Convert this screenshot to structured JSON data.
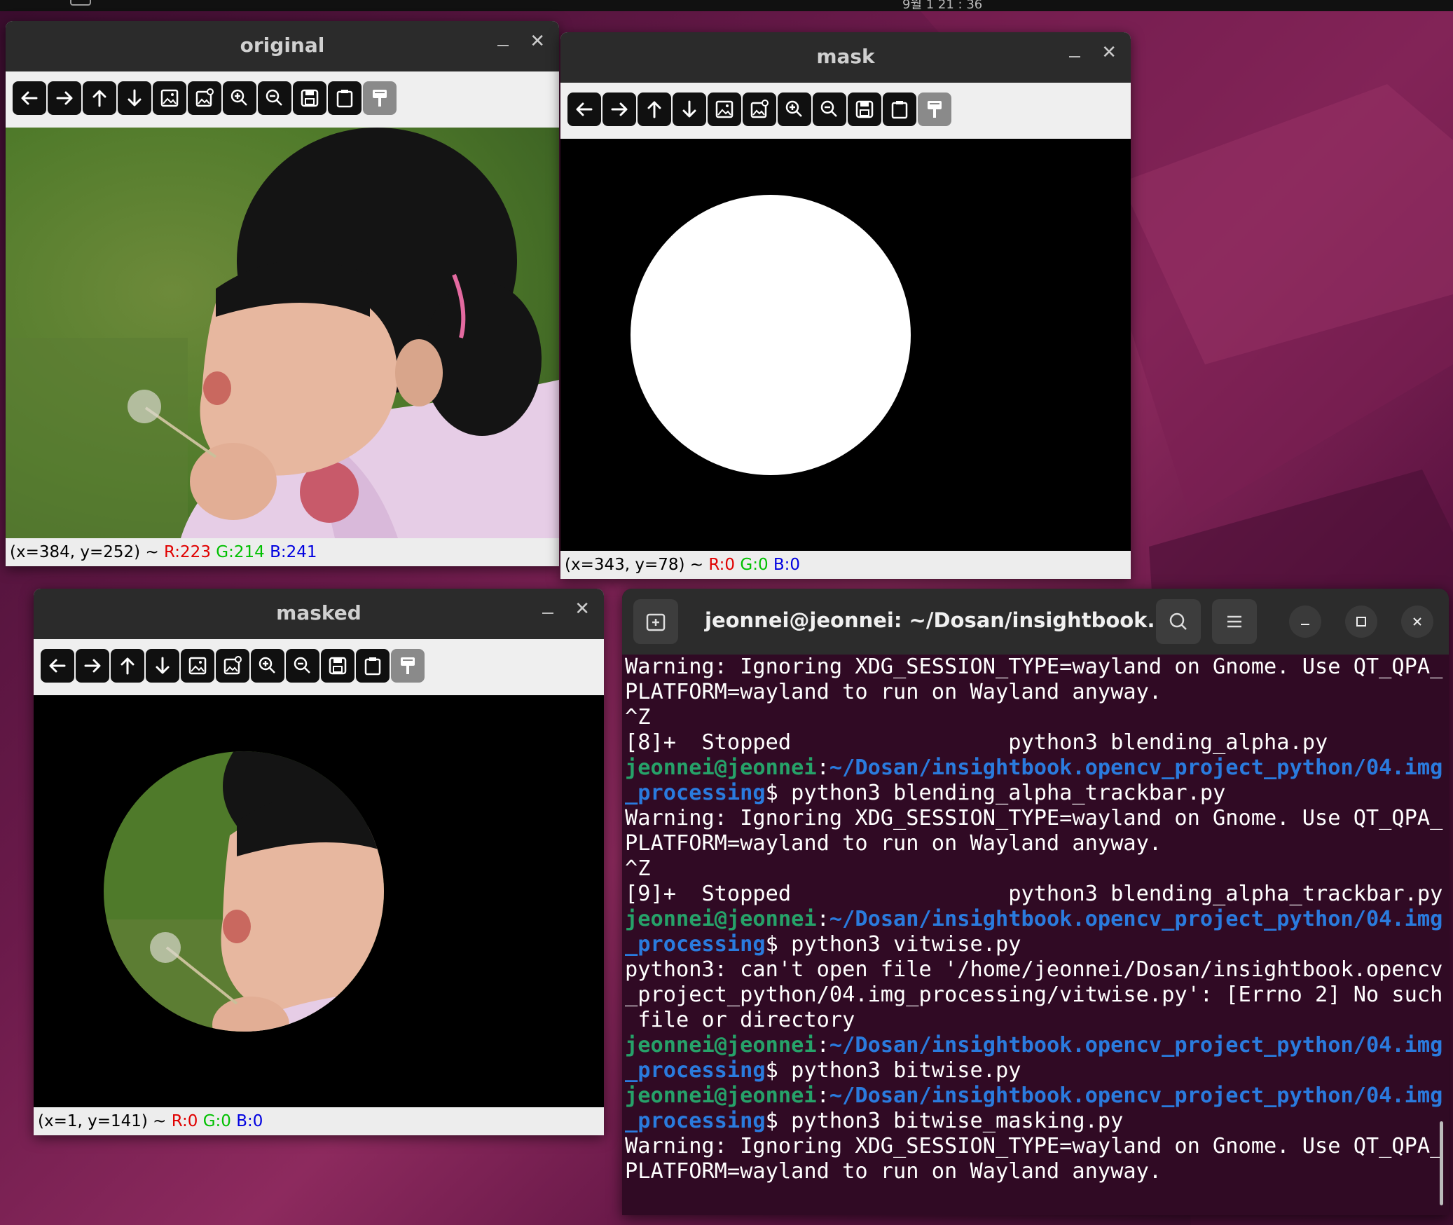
{
  "topbar": {
    "clock": "9월 1 21 : 36"
  },
  "windows": {
    "original": {
      "title": "original",
      "close_glyph": "✕",
      "status": {
        "coords": "(x=384, y=252) ~ ",
        "r": "R:223",
        "g": "G:214",
        "b": "B:241"
      }
    },
    "mask": {
      "title": "mask",
      "close_glyph": "✕",
      "status": {
        "coords": "(x=343, y=78) ~ ",
        "r": "R:0",
        "g": "G:0",
        "b": "B:0"
      }
    },
    "masked": {
      "title": "masked",
      "close_glyph": "✕",
      "status": {
        "coords": "(x=1, y=141) ~ ",
        "r": "R:0",
        "g": "G:0",
        "b": "B:0"
      }
    }
  },
  "toolbar_icons": [
    "arrow-left-icon",
    "arrow-right-icon",
    "arrow-up-icon",
    "arrow-down-icon",
    "image-icon",
    "image-settings-icon",
    "zoom-in-icon",
    "zoom-out-icon",
    "save-icon",
    "clipboard-icon",
    "paint-brush-icon"
  ],
  "terminal": {
    "title": "jeonnei@jeonnei: ~/Dosan/insightbook....",
    "user": "jeonnei@jeonnei",
    "colon": ":",
    "path1": "~/Dosan/insightbook.opencv_project_python/04.img",
    "path2": "_processing",
    "dollar": "$ ",
    "lines": {
      "w1": "Warning: Ignoring XDG_SESSION_TYPE=wayland on Gnome. Use QT_QPA_",
      "w2": "PLATFORM=wayland to run on Wayland anyway.",
      "ctrlz": "^Z",
      "stop8": "[8]+  Stopped                 python3 blending_alpha.py",
      "stop9": "[9]+  Stopped                 python3 blending_alpha_trackbar.py",
      "cmd1": "python3 blending_alpha_trackbar.py",
      "cmd2": "python3 vitwise.py",
      "err1": "python3: can't open file '/home/jeonnei/Dosan/insightbook.opencv",
      "err2": "_project_python/04.img_processing/vitwise.py': [Errno 2] No such",
      "err3": " file or directory",
      "cmd3": "python3 bitwise.py",
      "cmd4": "python3 bitwise_masking.py"
    }
  },
  "colors": {
    "terminal_bg": "#300a24",
    "prompt_user": "#26a269",
    "prompt_path": "#2a7bde"
  }
}
